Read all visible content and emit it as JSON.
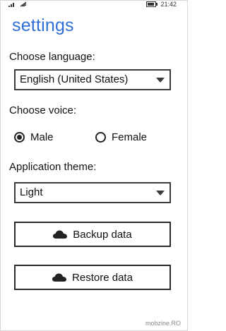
{
  "status_bar": {
    "time": "21:42"
  },
  "page": {
    "title": "settings"
  },
  "language": {
    "label": "Choose language:",
    "selected": "English (United States)"
  },
  "voice": {
    "label": "Choose voice:",
    "options": [
      {
        "label": "Male",
        "checked": true
      },
      {
        "label": "Female",
        "checked": false
      }
    ]
  },
  "theme": {
    "label": "Application theme:",
    "selected": "Light"
  },
  "buttons": {
    "backup": "Backup data",
    "restore": "Restore data"
  },
  "icons": [
    "signal-icon",
    "wifi-icon",
    "battery-icon",
    "cloud-icon"
  ],
  "colors": {
    "accent": "#2f6fd4",
    "border": "#2a2a2a"
  },
  "watermark": "mobzine.RO"
}
